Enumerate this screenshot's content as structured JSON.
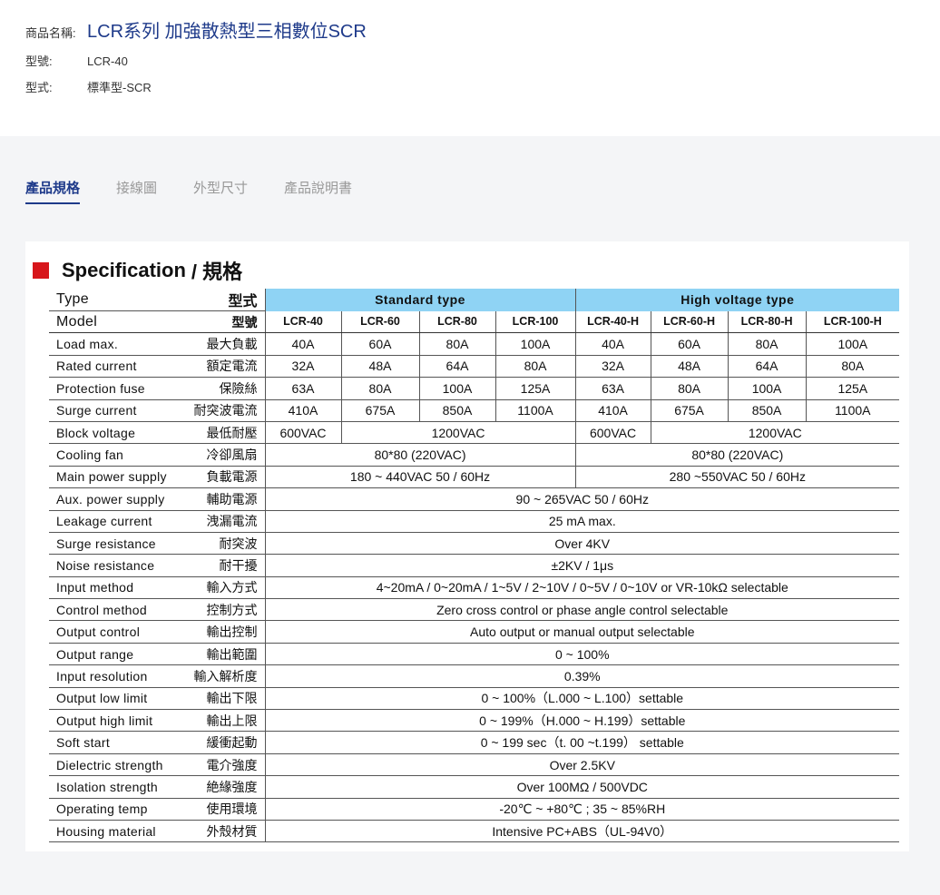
{
  "product": {
    "name_label": "商品名稱:",
    "name_value": "LCR系列 加強散熱型三相數位SCR",
    "model_label": "型號:",
    "model_value": "LCR-40",
    "type_label": "型式:",
    "type_value": "標準型-SCR"
  },
  "tabs": [
    {
      "label": "產品規格",
      "active": true
    },
    {
      "label": "接線圖",
      "active": false
    },
    {
      "label": "外型尺寸",
      "active": false
    },
    {
      "label": "產品說明書",
      "active": false
    }
  ],
  "spec": {
    "title_en": "Specification",
    "title_zh": "/ 規格",
    "accent_color": "#d7161b",
    "header_color": "#8fd3f4",
    "type_row": {
      "en": "Type",
      "zh": "型式",
      "standard": "Standard type",
      "high": "High voltage type"
    },
    "model_row": {
      "en": "Model",
      "zh": "型號",
      "models": [
        "LCR-40",
        "LCR-60",
        "LCR-80",
        "LCR-100",
        "LCR-40-H",
        "LCR-60-H",
        "LCR-80-H",
        "LCR-100-H"
      ]
    },
    "rows": [
      {
        "en": "Load max.",
        "zh": "最大負載",
        "cells": [
          [
            "40A",
            1
          ],
          [
            "60A",
            1
          ],
          [
            "80A",
            1
          ],
          [
            "100A",
            1
          ],
          [
            "40A",
            1
          ],
          [
            "60A",
            1
          ],
          [
            "80A",
            1
          ],
          [
            "100A",
            1
          ]
        ]
      },
      {
        "en": "Rated current",
        "zh": "額定電流",
        "cells": [
          [
            "32A",
            1
          ],
          [
            "48A",
            1
          ],
          [
            "64A",
            1
          ],
          [
            "80A",
            1
          ],
          [
            "32A",
            1
          ],
          [
            "48A",
            1
          ],
          [
            "64A",
            1
          ],
          [
            "80A",
            1
          ]
        ]
      },
      {
        "en": "Protection fuse",
        "zh": "保險絲",
        "cells": [
          [
            "63A",
            1
          ],
          [
            "80A",
            1
          ],
          [
            "100A",
            1
          ],
          [
            "125A",
            1
          ],
          [
            "63A",
            1
          ],
          [
            "80A",
            1
          ],
          [
            "100A",
            1
          ],
          [
            "125A",
            1
          ]
        ]
      },
      {
        "en": "Surge current",
        "zh": "耐突波電流",
        "cells": [
          [
            "410A",
            1
          ],
          [
            "675A",
            1
          ],
          [
            "850A",
            1
          ],
          [
            "1100A",
            1
          ],
          [
            "410A",
            1
          ],
          [
            "675A",
            1
          ],
          [
            "850A",
            1
          ],
          [
            "1100A",
            1
          ]
        ]
      },
      {
        "en": "Block voltage",
        "zh": "最低耐壓",
        "cells": [
          [
            "600VAC",
            1
          ],
          [
            "1200VAC",
            3
          ],
          [
            "600VAC",
            1
          ],
          [
            "1200VAC",
            3
          ]
        ]
      },
      {
        "en": "Cooling fan",
        "zh": "冷卻風扇",
        "cells": [
          [
            "80*80 (220VAC)",
            4
          ],
          [
            "80*80 (220VAC)",
            4
          ]
        ]
      },
      {
        "en": "Main power supply",
        "zh": "負載電源",
        "cells": [
          [
            "180 ~ 440VAC 50 / 60Hz",
            4
          ],
          [
            "280 ~550VAC 50 / 60Hz",
            4
          ]
        ]
      },
      {
        "en": "Aux. power supply",
        "zh": "輔助電源",
        "cells": [
          [
            "90 ~ 265VAC  50 / 60Hz",
            8
          ]
        ]
      },
      {
        "en": "Leakage current",
        "zh": "洩漏電流",
        "cells": [
          [
            "25 mA max.",
            8
          ]
        ]
      },
      {
        "en": "Surge resistance",
        "zh": "耐突波",
        "cells": [
          [
            "Over 4KV",
            8
          ]
        ]
      },
      {
        "en": "Noise resistance",
        "zh": "耐干擾",
        "cells": [
          [
            "±2KV / 1μs",
            8
          ]
        ]
      },
      {
        "en": "Input method",
        "zh": "輸入方式",
        "cells": [
          [
            "4~20mA / 0~20mA / 1~5V / 2~10V / 0~5V / 0~10V or VR-10kΩ selectable",
            8
          ]
        ]
      },
      {
        "en": "Control method",
        "zh": "控制方式",
        "cells": [
          [
            "Zero cross control or phase angle control selectable",
            8
          ]
        ]
      },
      {
        "en": "Output control",
        "zh": "輸出控制",
        "cells": [
          [
            "Auto output or manual output selectable",
            8
          ]
        ]
      },
      {
        "en": "Output range",
        "zh": "輸出範圍",
        "cells": [
          [
            "0 ~ 100%",
            8
          ]
        ]
      },
      {
        "en": "Input resolution",
        "zh": "輸入解析度",
        "cells": [
          [
            "0.39%",
            8
          ]
        ]
      },
      {
        "en": "Output low limit",
        "zh": "輸出下限",
        "cells": [
          [
            "0 ~ 100%（L.000 ~ L.100）settable",
            8
          ]
        ]
      },
      {
        "en": "Output high limit",
        "zh": "輸出上限",
        "cells": [
          [
            "0 ~ 199%（H.000 ~ H.199）settable",
            8
          ]
        ]
      },
      {
        "en": "Soft start",
        "zh": "緩衝起動",
        "cells": [
          [
            "0 ~ 199 sec（t. 00 ~t.199） settable",
            8
          ]
        ]
      },
      {
        "en": "Dielectric strength",
        "zh": "電介強度",
        "cells": [
          [
            "Over 2.5KV",
            8
          ]
        ]
      },
      {
        "en": "Isolation strength",
        "zh": "絶緣強度",
        "cells": [
          [
            "Over 100MΩ / 500VDC",
            8
          ]
        ]
      },
      {
        "en": "Operating temp",
        "zh": "使用環境",
        "cells": [
          [
            "-20℃ ~ +80℃ ; 35 ~ 85%RH",
            8
          ]
        ]
      },
      {
        "en": "Housing material",
        "zh": "外殼材質",
        "cells": [
          [
            "Intensive PC+ABS（UL-94V0）",
            8
          ]
        ]
      }
    ]
  }
}
